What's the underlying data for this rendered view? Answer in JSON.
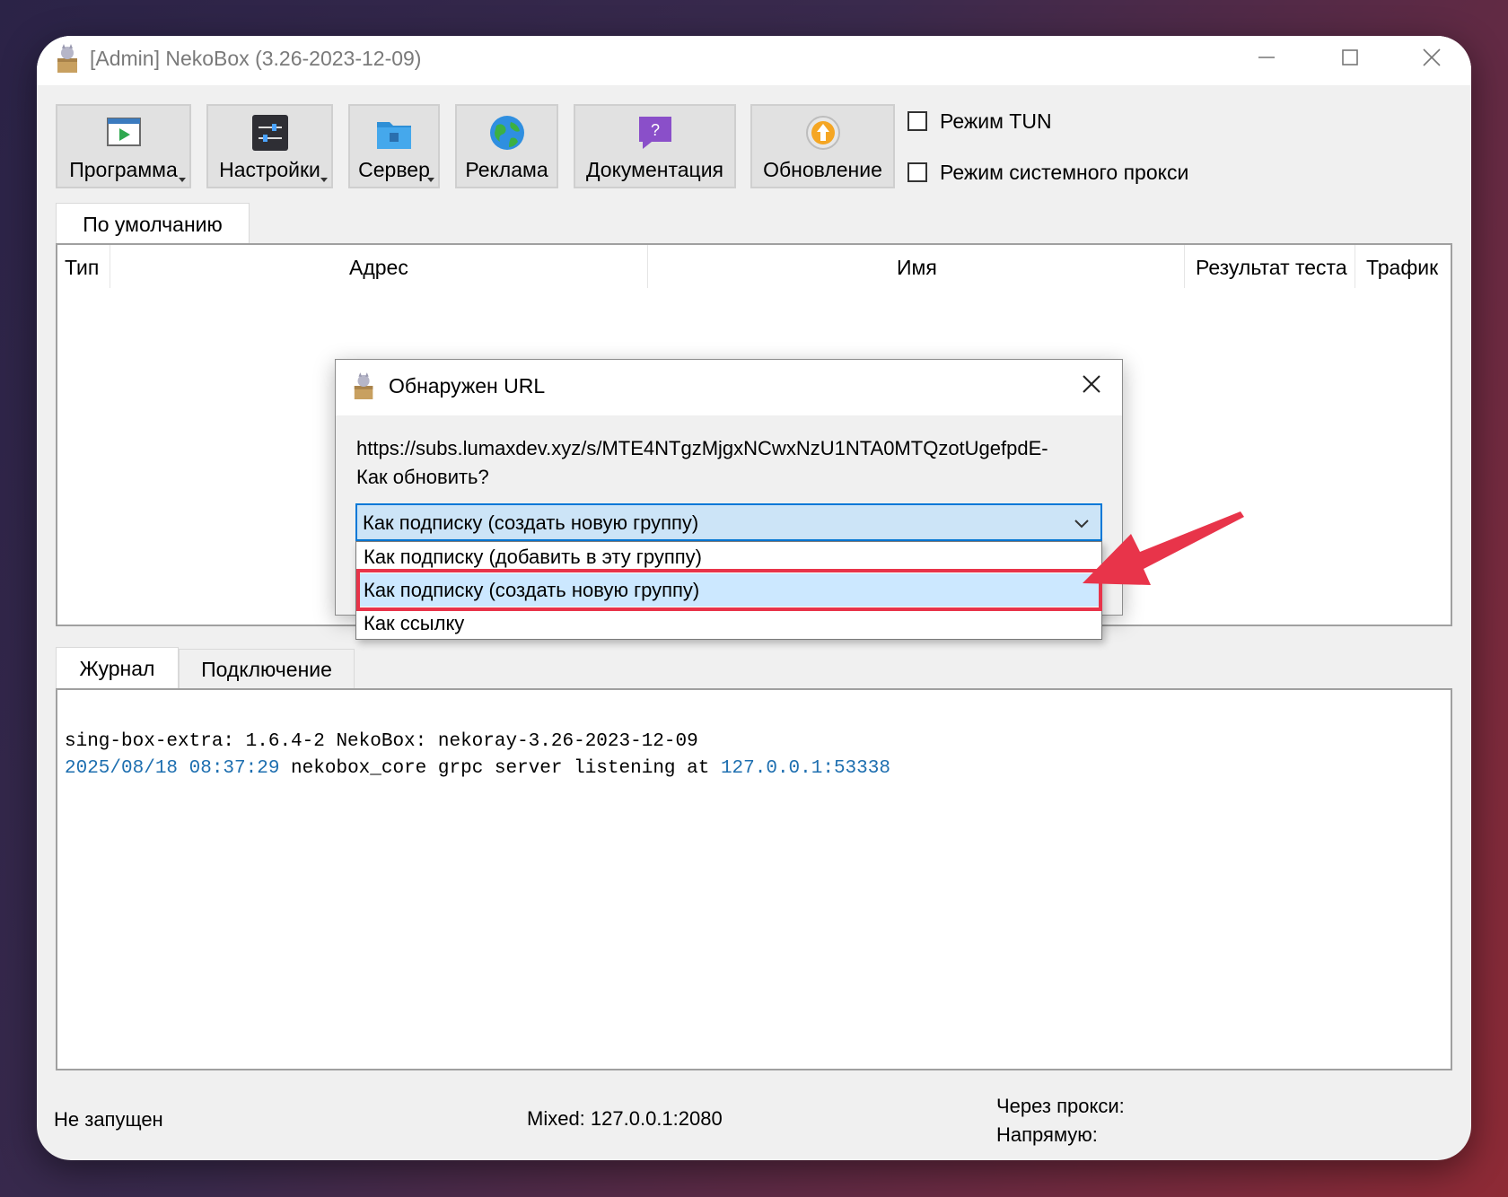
{
  "window": {
    "title": "[Admin] NekoBox (3.26-2023-12-09)"
  },
  "toolbar": {
    "buttons": [
      {
        "label": "Программа",
        "icon": "program-icon"
      },
      {
        "label": "Настройки",
        "icon": "settings-icon"
      },
      {
        "label": "Сервер",
        "icon": "server-icon"
      },
      {
        "label": "Реклама",
        "icon": "globe-icon"
      },
      {
        "label": "Документация",
        "icon": "documentation-icon"
      },
      {
        "label": "Обновление",
        "icon": "update-icon"
      }
    ],
    "checkboxes": [
      {
        "label": "Режим TUN",
        "checked": false
      },
      {
        "label": "Режим системного прокси",
        "checked": false
      }
    ]
  },
  "groups": {
    "tabs": [
      {
        "label": "По умолчанию"
      }
    ]
  },
  "server_table": {
    "columns": [
      "Тип",
      "Адрес",
      "Имя",
      "Результат теста",
      "Трафик"
    ]
  },
  "bottom_tabs": [
    {
      "label": "Журнал"
    },
    {
      "label": "Подключение"
    }
  ],
  "log": {
    "line1": "sing-box-extra: 1.6.4-2 NekoBox: nekoray-3.26-2023-12-09",
    "line2_time": "2025/08/18 08:37:29",
    "line2_msg": " nekobox_core grpc server listening at ",
    "line2_addr": "127.0.0.1:53338"
  },
  "status": {
    "state": "Не запущен",
    "mixed": "Mixed: 127.0.0.1:2080",
    "via_proxy": "Через прокси:",
    "direct": "Напрямую:"
  },
  "dialog": {
    "title": "Обнаружен URL",
    "url": "https://subs.lumaxdev.xyz/s/MTE4NTgzMjgxNCwxNzU1NTA0MTQzotUgefpdE-",
    "question": "Как обновить?",
    "selected": "Как подписку (создать новую группу)",
    "options": [
      "Как подписку (добавить в эту группу)",
      "Как подписку (создать новую группу)",
      "Как ссылку"
    ]
  },
  "colors": {
    "accent_blue": "#0078d7",
    "selection": "#cce4f7",
    "highlight_red": "#e8344a",
    "log_blue": "#1e6fb0"
  }
}
